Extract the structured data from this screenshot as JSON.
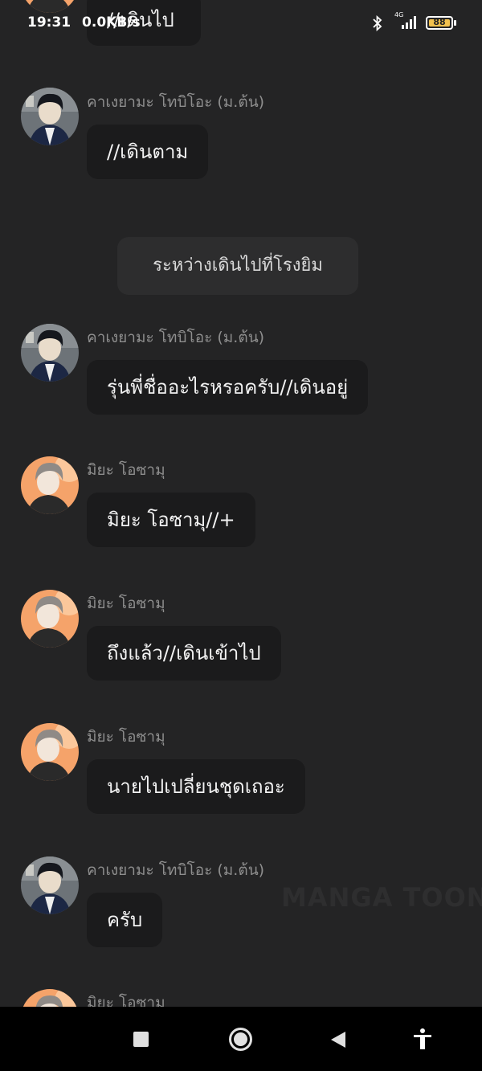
{
  "status_bar": {
    "time": "19:31",
    "net_speed": "0.0KB/s",
    "network_type": "4G",
    "battery": "88",
    "icons": [
      "bluetooth-icon",
      "signal-icon",
      "battery-icon"
    ]
  },
  "chat": {
    "top_partial_bubble": "//เดินไป",
    "messages": [
      {
        "sender": "คาเงยามะ โทบิโอะ (ม.ต้น)",
        "text": "//เดินตาม",
        "avatar": "kageyama"
      },
      {
        "sender": "คาเงยามะ โทบิโอะ (ม.ต้น)",
        "text": "รุ่นพี่ชื่ออะไรหรอครับ//เดินอยู่",
        "avatar": "kageyama"
      },
      {
        "sender": "มิยะ โอซามุ",
        "text": "มิยะ โอซามุ//+",
        "avatar": "osamu"
      },
      {
        "sender": "มิยะ โอซามุ",
        "text": "ถึงแล้ว//เดินเข้าไป",
        "avatar": "osamu"
      },
      {
        "sender": "มิยะ โอซามุ",
        "text": "นายไปเปลี่ยนชุดเถอะ",
        "avatar": "osamu"
      },
      {
        "sender": "คาเงยามะ โทบิโอะ (ม.ต้น)",
        "text": "ครับ",
        "avatar": "kageyama"
      },
      {
        "sender": "มิยะ โอซามุ",
        "text": "",
        "avatar": "osamu"
      }
    ],
    "system_message": "ระหว่างเดินไปที่โรงยิม"
  },
  "watermark": "MANGA TOON",
  "nav_bar": {
    "icons": [
      "recents-square-icon",
      "home-circle-icon",
      "back-triangle-icon",
      "accessibility-icon"
    ]
  },
  "colors": {
    "background": "#242425",
    "bubble": "#1b1b1c",
    "system_pill": "#2d2d2e",
    "name_text": "#8e8e8e",
    "nav_bar": "#000000",
    "battery_fill": "#f2c14e"
  }
}
